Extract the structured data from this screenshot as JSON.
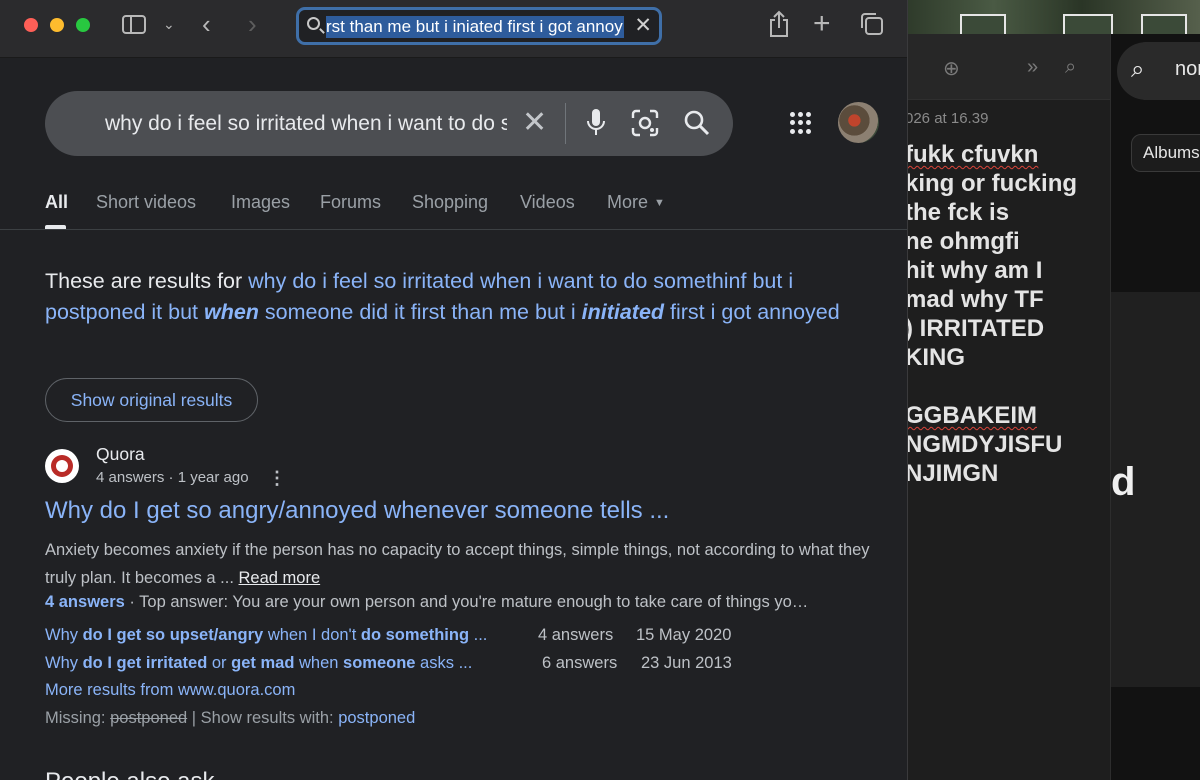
{
  "browser": {
    "url_text": "rst than me but i iniated first i got annoy"
  },
  "google": {
    "query": "why do i feel so irritated when i want to do s",
    "tabs": [
      "All",
      "Short videos",
      "Images",
      "Forums",
      "Shopping",
      "Videos",
      "More"
    ],
    "results_for": {
      "prefix": "These are results for ",
      "part1": "why do i feel so irritated when i want to do somethinf but i postponed it but ",
      "bold1": "when",
      "part2": " someone did it first than me but i ",
      "bold2": "initiated",
      "part3": " first i got annoyed"
    },
    "show_original": "Show original results",
    "result": {
      "source": "Quora",
      "meta": "4 answers · 1 year ago",
      "title": "Why do I get so angry/annoyed whenever someone tells ...",
      "snippet": "Anxiety becomes anxiety if the person has no capacity to accept things, simple things, not according to what they truly plan. It becomes a ... ",
      "read_more": "Read more",
      "answers_link": "4 answers",
      "top_answer": " · Top answer: You are your own person and you're mature enough to take care of things yo…",
      "related": [
        {
          "parts": [
            "Why ",
            "do",
            " ",
            "I get so upset/angry",
            " when I don't ",
            "do something",
            " ..."
          ],
          "answers": "4 answers",
          "date": "15 May 2020"
        },
        {
          "parts": [
            "Why ",
            "do",
            " ",
            "I get irritated",
            " or ",
            "get mad",
            " when ",
            "someone",
            " asks ..."
          ],
          "answers": "6 answers",
          "date": "23 Jun 2013"
        }
      ],
      "more_results": "More results from www.quora.com",
      "missing_label": "Missing: ",
      "missing_term": "postponed",
      "show_with_label": " | Show results with: ",
      "show_with_term": "postponed"
    },
    "cut_heading": "People also ask"
  },
  "notes": {
    "date": "026 at 16.39",
    "lines": [
      "fukk cfuvkn",
      "king or fucking",
      "the fck is",
      "ne ohmgfi",
      "hit why am I",
      "mad why TF",
      ") IRRITATED",
      "KING",
      "",
      "GGBAKEIM",
      "NGMDYJISFU",
      "NJIMGN"
    ]
  },
  "photos": {
    "search_text": "nor",
    "albums_chip": "Albums",
    "big_letter": "d"
  }
}
